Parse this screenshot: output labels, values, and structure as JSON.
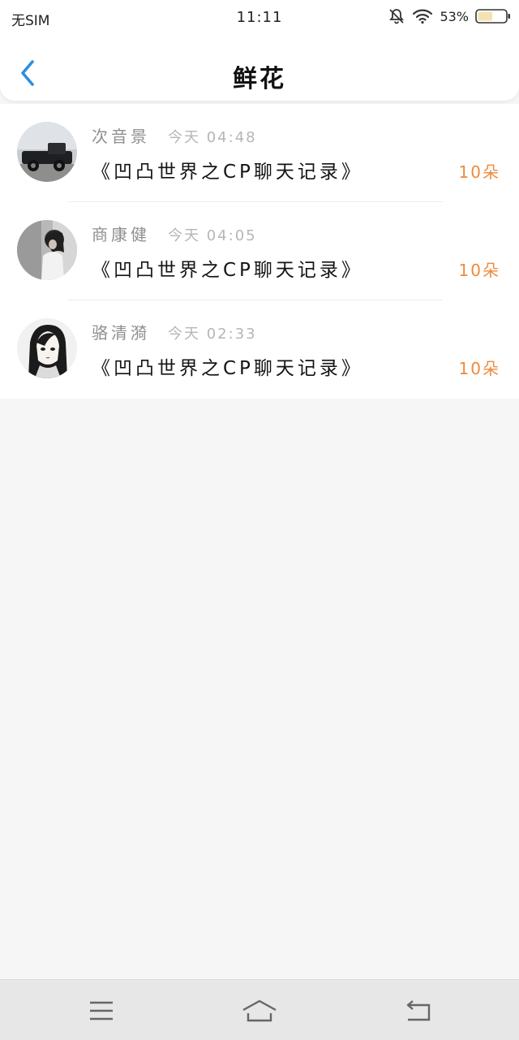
{
  "status_bar": {
    "carrier": "无SIM",
    "time": "11:11",
    "battery": "53%",
    "icons": [
      "bell-off-icon",
      "wifi-icon",
      "battery-icon"
    ]
  },
  "header": {
    "title": "鲜花",
    "back_icon": "chevron-left-icon",
    "accent_color": "#2b8fe0"
  },
  "records": [
    {
      "name": "次音景",
      "time": "今天 04:48",
      "subject": "《凹凸世界之CP聊天记录》",
      "count": "10朵"
    },
    {
      "name": "商康健",
      "time": "今天 04:05",
      "subject": "《凹凸世界之CP聊天记录》",
      "count": "10朵"
    },
    {
      "name": "骆清漪",
      "time": "今天 02:33",
      "subject": "《凹凸世界之CP聊天记录》",
      "count": "10朵"
    }
  ],
  "count_color": "#ee8a3c",
  "system_nav": {
    "icons": [
      "menu-icon",
      "home-icon",
      "back-icon"
    ]
  }
}
